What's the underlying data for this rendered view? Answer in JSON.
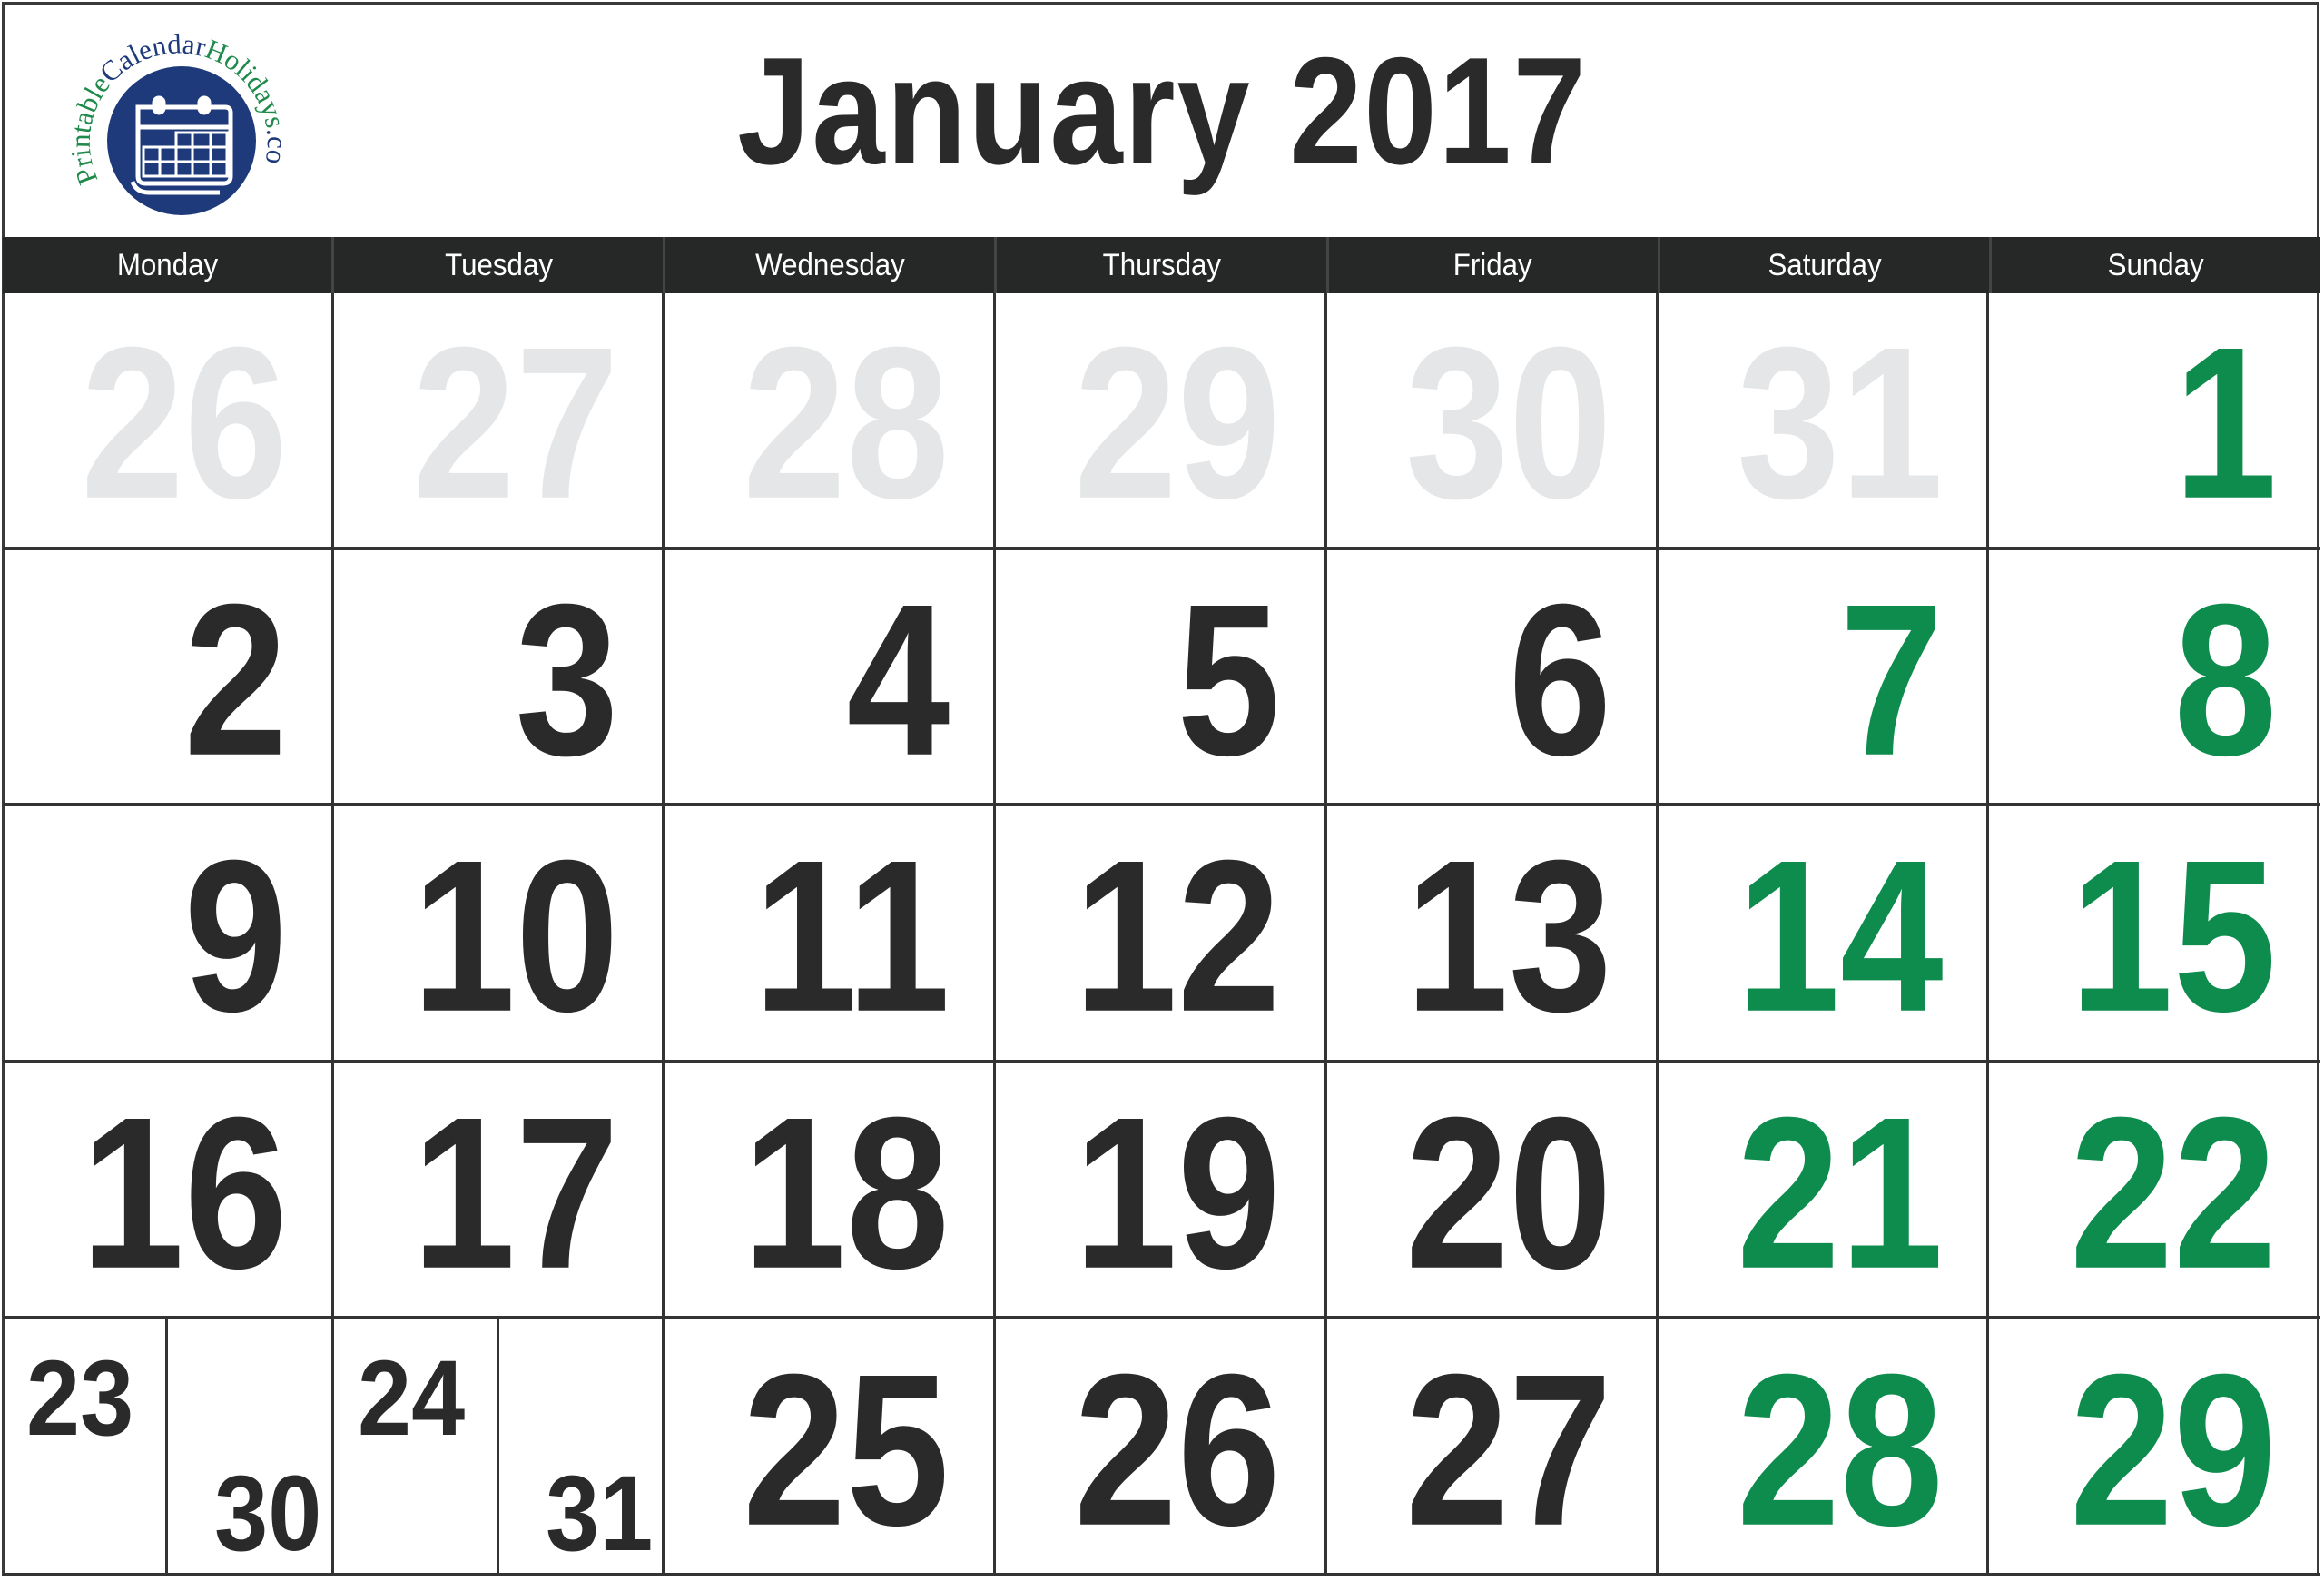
{
  "logo": {
    "text_parts": [
      {
        "text": "Printable",
        "color": "#1f8a4c"
      },
      {
        "text": "Calendar",
        "color": "#1e3a7b"
      },
      {
        "text": "Holidays",
        "color": "#1f8a4c"
      },
      {
        "text": ".com",
        "color": "#1e3a7b"
      }
    ],
    "circle_color": "#1e3a7b",
    "icon": "calendar-icon"
  },
  "title": "January 2017",
  "colors": {
    "text": "#2a2a2a",
    "weekend": "#0e8c4e",
    "other_month": "#e5e6e7",
    "header_bg": "#262827"
  },
  "weekdays": [
    "Monday",
    "Tuesday",
    "Wednesday",
    "Thursday",
    "Friday",
    "Saturday",
    "Sunday"
  ],
  "weeks": [
    [
      {
        "day": "26",
        "type": "muted"
      },
      {
        "day": "27",
        "type": "muted"
      },
      {
        "day": "28",
        "type": "muted"
      },
      {
        "day": "29",
        "type": "muted"
      },
      {
        "day": "30",
        "type": "muted"
      },
      {
        "day": "31",
        "type": "muted"
      },
      {
        "day": "1",
        "type": "weekend"
      }
    ],
    [
      {
        "day": "2",
        "type": "normal"
      },
      {
        "day": "3",
        "type": "normal"
      },
      {
        "day": "4",
        "type": "normal"
      },
      {
        "day": "5",
        "type": "normal"
      },
      {
        "day": "6",
        "type": "normal"
      },
      {
        "day": "7",
        "type": "weekend"
      },
      {
        "day": "8",
        "type": "weekend"
      }
    ],
    [
      {
        "day": "9",
        "type": "normal"
      },
      {
        "day": "10",
        "type": "normal"
      },
      {
        "day": "11",
        "type": "normal"
      },
      {
        "day": "12",
        "type": "normal"
      },
      {
        "day": "13",
        "type": "normal"
      },
      {
        "day": "14",
        "type": "weekend"
      },
      {
        "day": "15",
        "type": "weekend"
      }
    ],
    [
      {
        "day": "16",
        "type": "normal"
      },
      {
        "day": "17",
        "type": "normal"
      },
      {
        "day": "18",
        "type": "normal"
      },
      {
        "day": "19",
        "type": "normal"
      },
      {
        "day": "20",
        "type": "normal"
      },
      {
        "day": "21",
        "type": "weekend"
      },
      {
        "day": "22",
        "type": "weekend"
      }
    ],
    [
      {
        "split": [
          "23",
          "30"
        ],
        "type": "split"
      },
      {
        "split": [
          "24",
          "31"
        ],
        "type": "split"
      },
      {
        "day": "25",
        "type": "normal"
      },
      {
        "day": "26",
        "type": "normal"
      },
      {
        "day": "27",
        "type": "normal"
      },
      {
        "day": "28",
        "type": "weekend"
      },
      {
        "day": "29",
        "type": "weekend"
      }
    ]
  ]
}
